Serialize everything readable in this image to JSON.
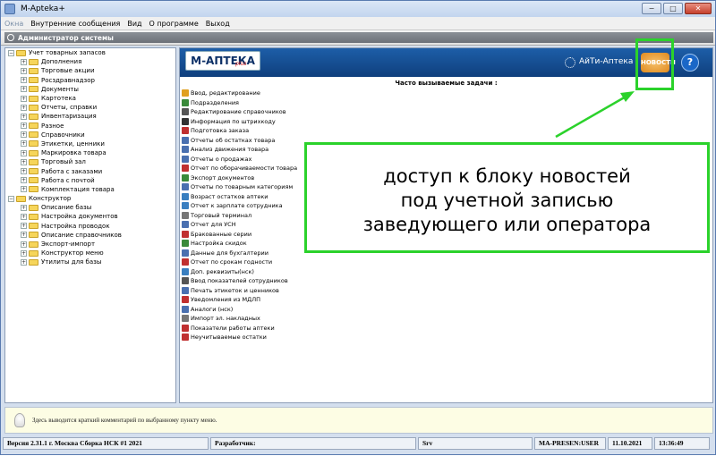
{
  "window": {
    "title": "M-Apteka+",
    "buttons": [
      "−",
      "□",
      "✕"
    ]
  },
  "menu": [
    "Окна",
    "Внутренние сообщения",
    "Вид",
    "О программе",
    "Выход"
  ],
  "user_bar": {
    "label": "Администратор системы"
  },
  "tree": [
    {
      "label": "Учет товарных запасов",
      "level": 0,
      "expander": "−"
    },
    {
      "label": "Дополнения",
      "level": 1,
      "expander": "+"
    },
    {
      "label": "Торговые акции",
      "level": 1,
      "expander": "+"
    },
    {
      "label": "Росздравнадзор",
      "level": 1,
      "expander": "+"
    },
    {
      "label": "Документы",
      "level": 1,
      "expander": "+"
    },
    {
      "label": "Картотека",
      "level": 1,
      "expander": "+"
    },
    {
      "label": "Отчеты, справки",
      "level": 1,
      "expander": "+"
    },
    {
      "label": "Инвентаризация",
      "level": 1,
      "expander": "+"
    },
    {
      "label": "Разное",
      "level": 1,
      "expander": "+"
    },
    {
      "label": "Справочники",
      "level": 1,
      "expander": "+"
    },
    {
      "label": "Этикетки, ценники",
      "level": 1,
      "expander": "+"
    },
    {
      "label": "Маркировка товара",
      "level": 1,
      "expander": "+"
    },
    {
      "label": "Торговый зал",
      "level": 1,
      "expander": "+"
    },
    {
      "label": "Работа с заказами",
      "level": 1,
      "expander": "+"
    },
    {
      "label": "Работа с почтой",
      "level": 1,
      "expander": "+"
    },
    {
      "label": "Комплектация товара",
      "level": 1,
      "expander": "+"
    },
    {
      "label": "Конструктор",
      "level": 0,
      "expander": "−"
    },
    {
      "label": "Описание базы",
      "level": 1,
      "expander": "+"
    },
    {
      "label": "Настройка документов",
      "level": 1,
      "expander": "+"
    },
    {
      "label": "Настройка проводок",
      "level": 1,
      "expander": "+"
    },
    {
      "label": "Описание справочников",
      "level": 1,
      "expander": "+"
    },
    {
      "label": "Экспорт-импорт",
      "level": 1,
      "expander": "+"
    },
    {
      "label": "Конструктор меню",
      "level": 1,
      "expander": "+"
    },
    {
      "label": "Утилиты для базы",
      "level": 1,
      "expander": "+"
    }
  ],
  "banner": {
    "logo": "М-АПТЕКА",
    "logo_sub": "plus",
    "itc_label": "АйТи-Аптека",
    "news_button": "НОВОСТИ",
    "help_button": "?"
  },
  "tasks_title": "Часто вызываемые задачи :",
  "tasks": [
    {
      "label": "Ввод, редактирование",
      "color": "#e0a020"
    },
    {
      "label": "Подразделения",
      "color": "#3a8a3a"
    },
    {
      "label": "Редактирование справочников",
      "color": "#555555"
    },
    {
      "label": "Информация по штрихкоду",
      "color": "#333333"
    },
    {
      "label": "Подготовка заказа",
      "color": "#c03030"
    },
    {
      "label": "Отчеты об остатках товара",
      "color": "#4a70b0"
    },
    {
      "label": "Анализ движения товара",
      "color": "#4a70b0"
    },
    {
      "label": "Отчеты о продажах",
      "color": "#4a70b0"
    },
    {
      "label": "Отчет по оборачиваемости товара",
      "color": "#c03030"
    },
    {
      "label": "Экспорт документов",
      "color": "#3a8a3a"
    },
    {
      "label": "Отчеты по товарным категориям",
      "color": "#4a70b0"
    },
    {
      "label": "Возраст остатков аптеки",
      "color": "#3a7fc0"
    },
    {
      "label": "Отчет к зарплате сотрудника",
      "color": "#3a7fc0"
    },
    {
      "label": "Торговый терминал",
      "color": "#777777"
    },
    {
      "label": "Отчет для УСН",
      "color": "#4a70b0"
    },
    {
      "label": "Бракованные серии",
      "color": "#c03030"
    },
    {
      "label": "Настройка скидок",
      "color": "#3a8a3a"
    },
    {
      "label": "Данные для бухгалтерии",
      "color": "#4a70b0"
    },
    {
      "label": "Отчет по срокам годности",
      "color": "#c03030"
    },
    {
      "label": "Доп. реквизиты(нск)",
      "color": "#3a7fc0"
    },
    {
      "label": "Ввод показателей сотрудников",
      "color": "#555555"
    },
    {
      "label": "Печать этикеток и ценников",
      "color": "#4a70b0"
    },
    {
      "label": "Уведомления из МДЛП",
      "color": "#c03030"
    },
    {
      "label": "Аналоги (нск)",
      "color": "#4a70b0"
    },
    {
      "label": "Импорт эл. накладных",
      "color": "#777777"
    },
    {
      "label": "Показатели работы аптеки",
      "color": "#c03030"
    },
    {
      "label": "Неучитываемые остатки",
      "color": "#c03030"
    }
  ],
  "annotation": {
    "lines": [
      "доступ к блоку новостей",
      "под учетной записью",
      "заведующего или оператора"
    ],
    "color": "#2bd22b"
  },
  "hint": "Здесь выводится краткий комментарий по выбранному пункту меню.",
  "status": {
    "version": "Версия 2.31.1 г. Москва  Сборка НСК #1 2021",
    "developer": "Разработчик:",
    "server": "Srv",
    "user": "MA-PRESEN:USER",
    "date": "11.10.2021",
    "time": "13:36:49"
  }
}
